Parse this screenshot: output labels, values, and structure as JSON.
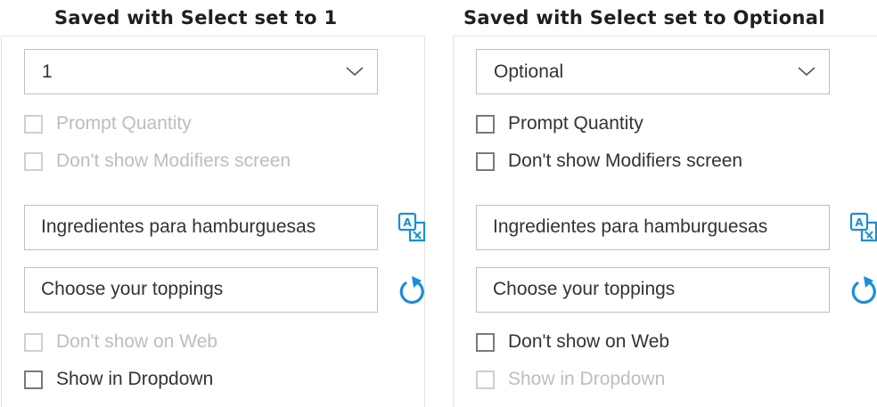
{
  "left": {
    "heading": "Saved with Select set to 1",
    "select_value": "1",
    "prompt_quantity": "Prompt Quantity",
    "dont_show_modifiers": "Don't show Modifiers screen",
    "name_field": "Ingredientes para hamburguesas",
    "description_field": "Choose your toppings",
    "dont_show_on_web": "Don't show on Web",
    "show_in_dropdown": "Show in Dropdown"
  },
  "right": {
    "heading": "Saved with Select set to Optional",
    "select_value": "Optional",
    "prompt_quantity": "Prompt Quantity",
    "dont_show_modifiers": "Don't show Modifiers screen",
    "name_field": "Ingredientes para hamburguesas",
    "description_field": "Choose your toppings",
    "dont_show_on_web": "Don't show on Web",
    "show_in_dropdown": "Show in Dropdown"
  },
  "icons": {
    "chevron": "chevron-down-icon",
    "translate": "translate-icon",
    "reset": "refresh-icon"
  },
  "colors": {
    "accent": "#1a8fd6",
    "disabled_text": "#bdbdbd",
    "border": "#bfbfbf"
  }
}
